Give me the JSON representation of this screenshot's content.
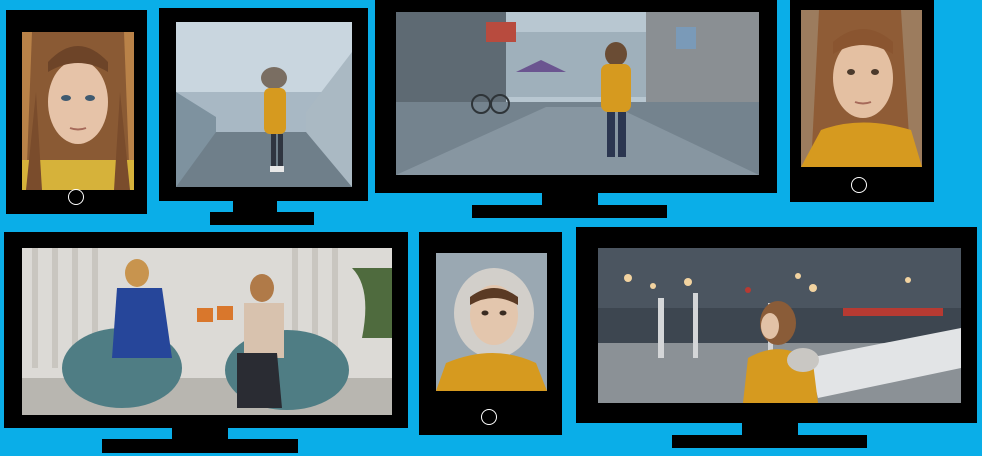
{
  "colors": {
    "background": "#0aaee8",
    "device_frame": "#000000",
    "home_button": "#ffffff",
    "coat_yellow": "#d69a1f"
  },
  "devices": [
    {
      "type": "tablet",
      "scene": "girl-close-up-portrait",
      "has_home_button": true
    },
    {
      "type": "monitor",
      "scene": "girl-walking-on-bridge",
      "has_stand": true
    },
    {
      "type": "monitor",
      "scene": "girl-walking-on-street",
      "has_stand": true
    },
    {
      "type": "tablet",
      "scene": "girl-portrait-side-glance",
      "has_home_button": true
    },
    {
      "type": "monitor",
      "scene": "mother-and-daughter-on-beanbags",
      "has_stand": true
    },
    {
      "type": "tablet",
      "scene": "girl-in-fur-hood",
      "has_home_button": true
    },
    {
      "type": "monitor",
      "scene": "girl-on-station-bench",
      "has_stand": true
    }
  ]
}
